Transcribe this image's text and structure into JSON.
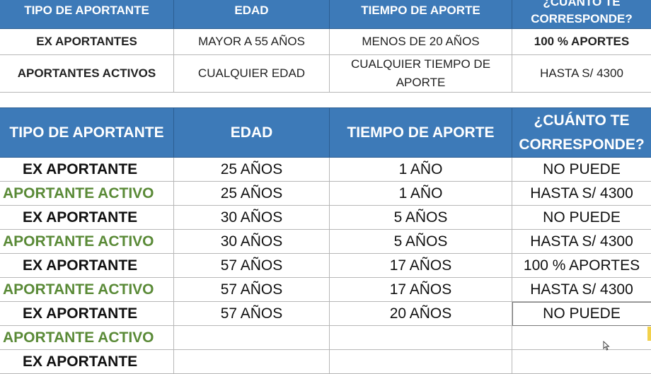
{
  "table1": {
    "headers": [
      "TIPO DE APORTANTE",
      "EDAD",
      "TIEMPO DE APORTE",
      "¿CUÁNTO TE",
      "CORRESPONDE?"
    ],
    "rows": [
      [
        "EX APORTANTES",
        "MAYOR A 55 AÑOS",
        "MENOS DE 20 AÑOS",
        "100 % APORTES"
      ],
      [
        "APORTANTES ACTIVOS",
        "CUALQUIER EDAD",
        "CUALQUIER TIEMPO DE",
        "APORTE",
        "HASTA S/ 4300"
      ]
    ]
  },
  "table2": {
    "headers": [
      "TIPO DE APORTANTE",
      "EDAD",
      "TIEMPO DE APORTE",
      "¿CUÁNTO TE",
      "CORRESPONDE?"
    ],
    "rows": [
      [
        "EX APORTANTE",
        "25 AÑOS",
        "1 AÑO",
        "NO PUEDE"
      ],
      [
        "APORTANTE ACTIVO",
        "25 AÑOS",
        "1 AÑO",
        "HASTA S/ 4300"
      ],
      [
        "EX APORTANTE",
        "30 AÑOS",
        "5 AÑOS",
        "NO PUEDE"
      ],
      [
        "APORTANTE ACTIVO",
        "30 AÑOS",
        "5 AÑOS",
        "HASTA S/ 4300"
      ],
      [
        "EX APORTANTE",
        "57 AÑOS",
        "17 AÑOS",
        "100 % APORTES"
      ],
      [
        "APORTANTE ACTIVO",
        "57 AÑOS",
        "17 AÑOS",
        "HASTA S/ 4300"
      ],
      [
        "EX APORTANTE",
        "57 AÑOS",
        "20 AÑOS",
        "NO PUEDE"
      ],
      [
        "APORTANTE ACTIVO",
        "",
        "",
        ""
      ],
      [
        "EX APORTANTE",
        "",
        "",
        ""
      ]
    ]
  },
  "colors": {
    "header_bg": "#3d7ab8",
    "active_green": "#5a8a37"
  }
}
